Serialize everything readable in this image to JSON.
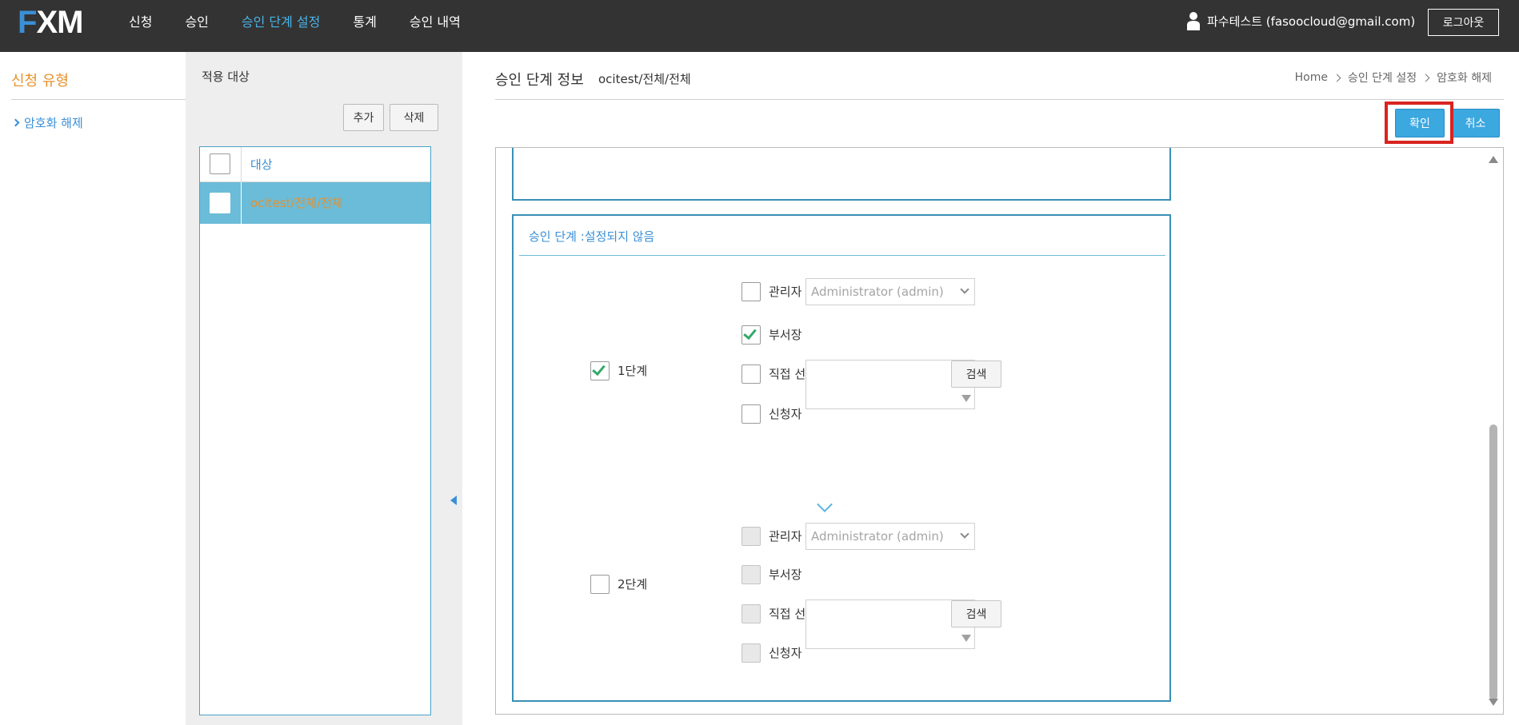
{
  "app": {
    "logo_f": "F",
    "logo_rest": "XM"
  },
  "nav": [
    {
      "label": "신청"
    },
    {
      "label": "승인"
    },
    {
      "label": "승인 단계 설정"
    },
    {
      "label": "통계"
    },
    {
      "label": "승인 내역"
    }
  ],
  "user": {
    "name": "파수테스트 (fasoocloud@gmail.com)",
    "logout_label": "로그아웃"
  },
  "sidebar": {
    "title": "신청 유형",
    "items": [
      {
        "label": "암호화 해제"
      }
    ]
  },
  "target": {
    "title": "적용 대상",
    "add_label": "추가",
    "delete_label": "삭제",
    "header_label": "대상",
    "rows": [
      {
        "label": "ocitest/전체/전체"
      }
    ]
  },
  "main": {
    "title": "승인 단계 정보",
    "subtitle": "ocitest/전체/전체",
    "breadcrumb": [
      "Home",
      "승인 단계 설정",
      "암호화 해제"
    ],
    "confirm_label": "확인",
    "cancel_label": "취소",
    "step_section_title": "승인 단계 :설정되지 않음",
    "steps": [
      {
        "label": "1단계",
        "checked": true,
        "options": {
          "manager_label": "관리자",
          "manager_select": "Administrator (admin)",
          "dept_head_label": "부서장",
          "direct_label": "직접 선택",
          "search_label": "검색",
          "requester_label": "신청자"
        }
      },
      {
        "label": "2단계",
        "checked": false,
        "options": {
          "manager_label": "관리자",
          "manager_select": "Administrator (admin)",
          "dept_head_label": "부서장",
          "direct_label": "직접 선택",
          "search_label": "검색",
          "requester_label": "신청자"
        }
      }
    ]
  },
  "colors": {
    "accent": "#3ba8e0",
    "topbar": "#333333",
    "orange": "#e8902b",
    "highlight": "#d9241f"
  }
}
